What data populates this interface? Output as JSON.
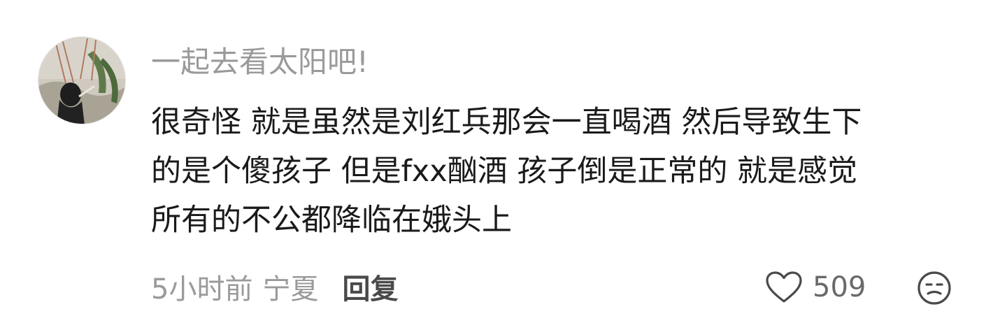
{
  "comment": {
    "username": "一起去看太阳吧!",
    "lines": [
      "很奇怪 就是虽然是刘红兵那会一直喝酒 然后导致生下",
      "的是个傻孩子 但是fxx酗酒 孩子倒是正常的 就是感觉",
      "所有的不公都降临在娥头上"
    ],
    "time": "5小时前",
    "location": "宁夏",
    "reply_label": "回复",
    "like_count": "509",
    "icons": {
      "like": "heart-outline-icon",
      "dislike": "meh-face-icon",
      "avatar": "user-avatar"
    },
    "colors": {
      "username": "#9a9a9a",
      "body": "#1a1a1a",
      "meta": "#9a9a9a",
      "reply": "#4a4a4a"
    }
  }
}
